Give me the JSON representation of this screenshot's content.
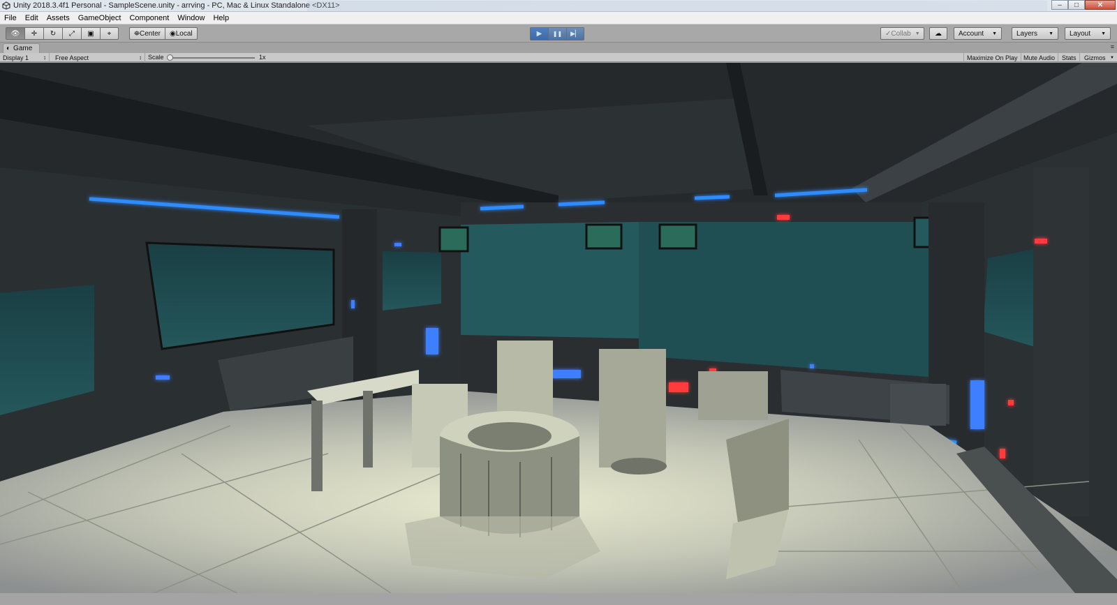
{
  "window": {
    "title": "Unity 2018.3.4f1 Personal - SampleScene.unity - arrving - PC, Mac & Linux Standalone <DX11>",
    "minimize": "–",
    "maximize": "□",
    "close": "✕"
  },
  "menu": [
    "File",
    "Edit",
    "Assets",
    "GameObject",
    "Component",
    "Window",
    "Help"
  ],
  "toolbar": {
    "tools": [
      {
        "name": "view-tool",
        "icon": "eye-icon",
        "glyph": "👁"
      },
      {
        "name": "move-tool",
        "icon": "move-icon",
        "glyph": "✛"
      },
      {
        "name": "rotate-tool",
        "icon": "rotate-icon",
        "glyph": "↻"
      },
      {
        "name": "scale-tool",
        "icon": "scale-icon",
        "glyph": "⤢"
      },
      {
        "name": "rect-tool",
        "icon": "rect-icon",
        "glyph": "▣"
      },
      {
        "name": "transform-tool",
        "icon": "transform-icon",
        "glyph": "⌖"
      }
    ],
    "pivot_label": "Center",
    "pivot_glyph": "⛯",
    "space_label": "Local",
    "space_glyph": "◉",
    "play_glyph": "▶",
    "pause_glyph": "❚❚",
    "step_glyph": "▶▏",
    "collab_label": "Collab",
    "collab_glyph": "✓",
    "cloud_glyph": "☁",
    "account_label": "Account",
    "layers_label": "Layers",
    "layout_label": "Layout",
    "caret": "▼"
  },
  "game_tab": {
    "label": "Game",
    "icon_glyph": "◐",
    "menu_glyph": "≡"
  },
  "game_toolbar": {
    "display": "Display 1",
    "aspect": "Free Aspect",
    "scale_label": "Scale",
    "scale_value": "1x",
    "scale_fraction": 0.0,
    "maximize_on_play": "Maximize On Play",
    "mute_audio": "Mute Audio",
    "stats": "Stats",
    "gizmos": "Gizmos",
    "updown": "↕",
    "caret": "▼"
  },
  "colors": {
    "play_active": "#3c69a8",
    "neon_blue": "#2f8cff",
    "neon_red": "#ff3a3a",
    "window_screen": "#1f4a4d",
    "floor": "#c9ccbd"
  }
}
